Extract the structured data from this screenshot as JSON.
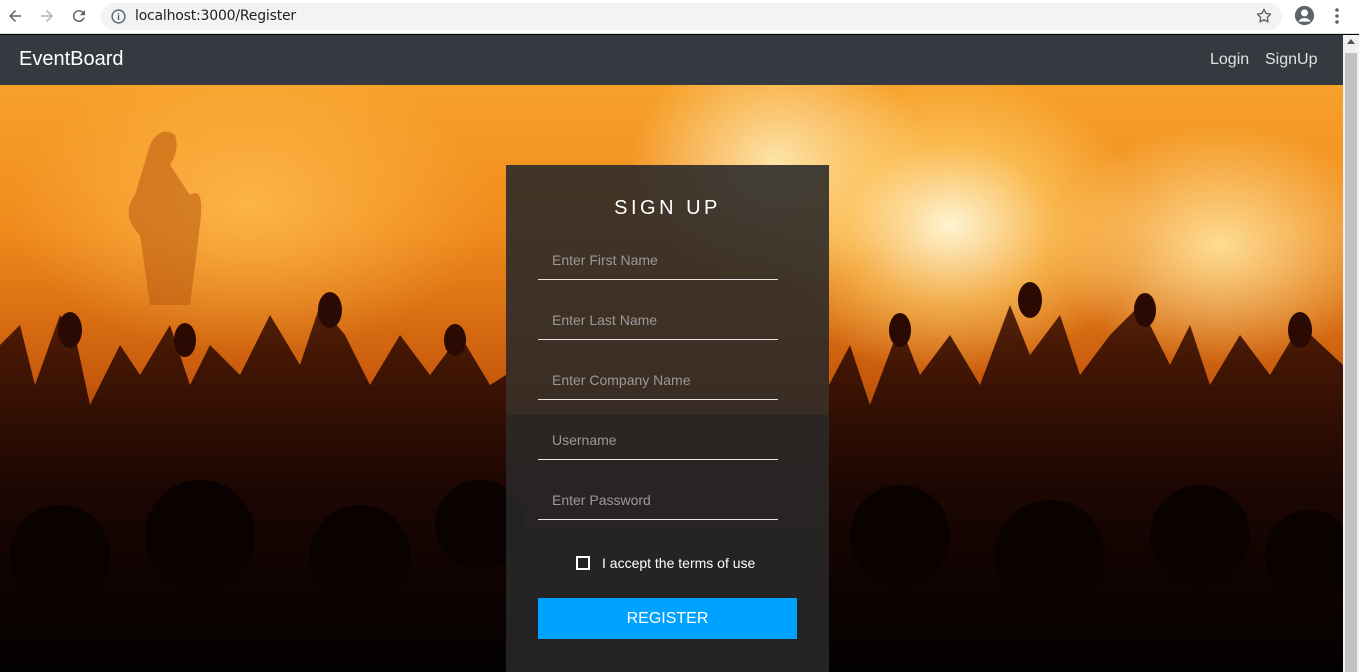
{
  "browser": {
    "url": "localhost:3000/Register"
  },
  "navbar": {
    "brand": "EventBoard",
    "links": [
      {
        "label": "Login"
      },
      {
        "label": "SignUp"
      }
    ],
    "background": "#343a40"
  },
  "signup_form": {
    "title": "SIGN UP",
    "fields": [
      {
        "placeholder": "Enter First Name",
        "value": ""
      },
      {
        "placeholder": "Enter Last Name",
        "value": ""
      },
      {
        "placeholder": "Enter Company Name",
        "value": ""
      },
      {
        "placeholder": "Username",
        "value": ""
      },
      {
        "placeholder": "Enter Password",
        "value": ""
      }
    ],
    "terms_label": "I accept the terms of use",
    "terms_checked": false,
    "submit_label": "REGISTER",
    "accent_color": "#00a2ff"
  }
}
